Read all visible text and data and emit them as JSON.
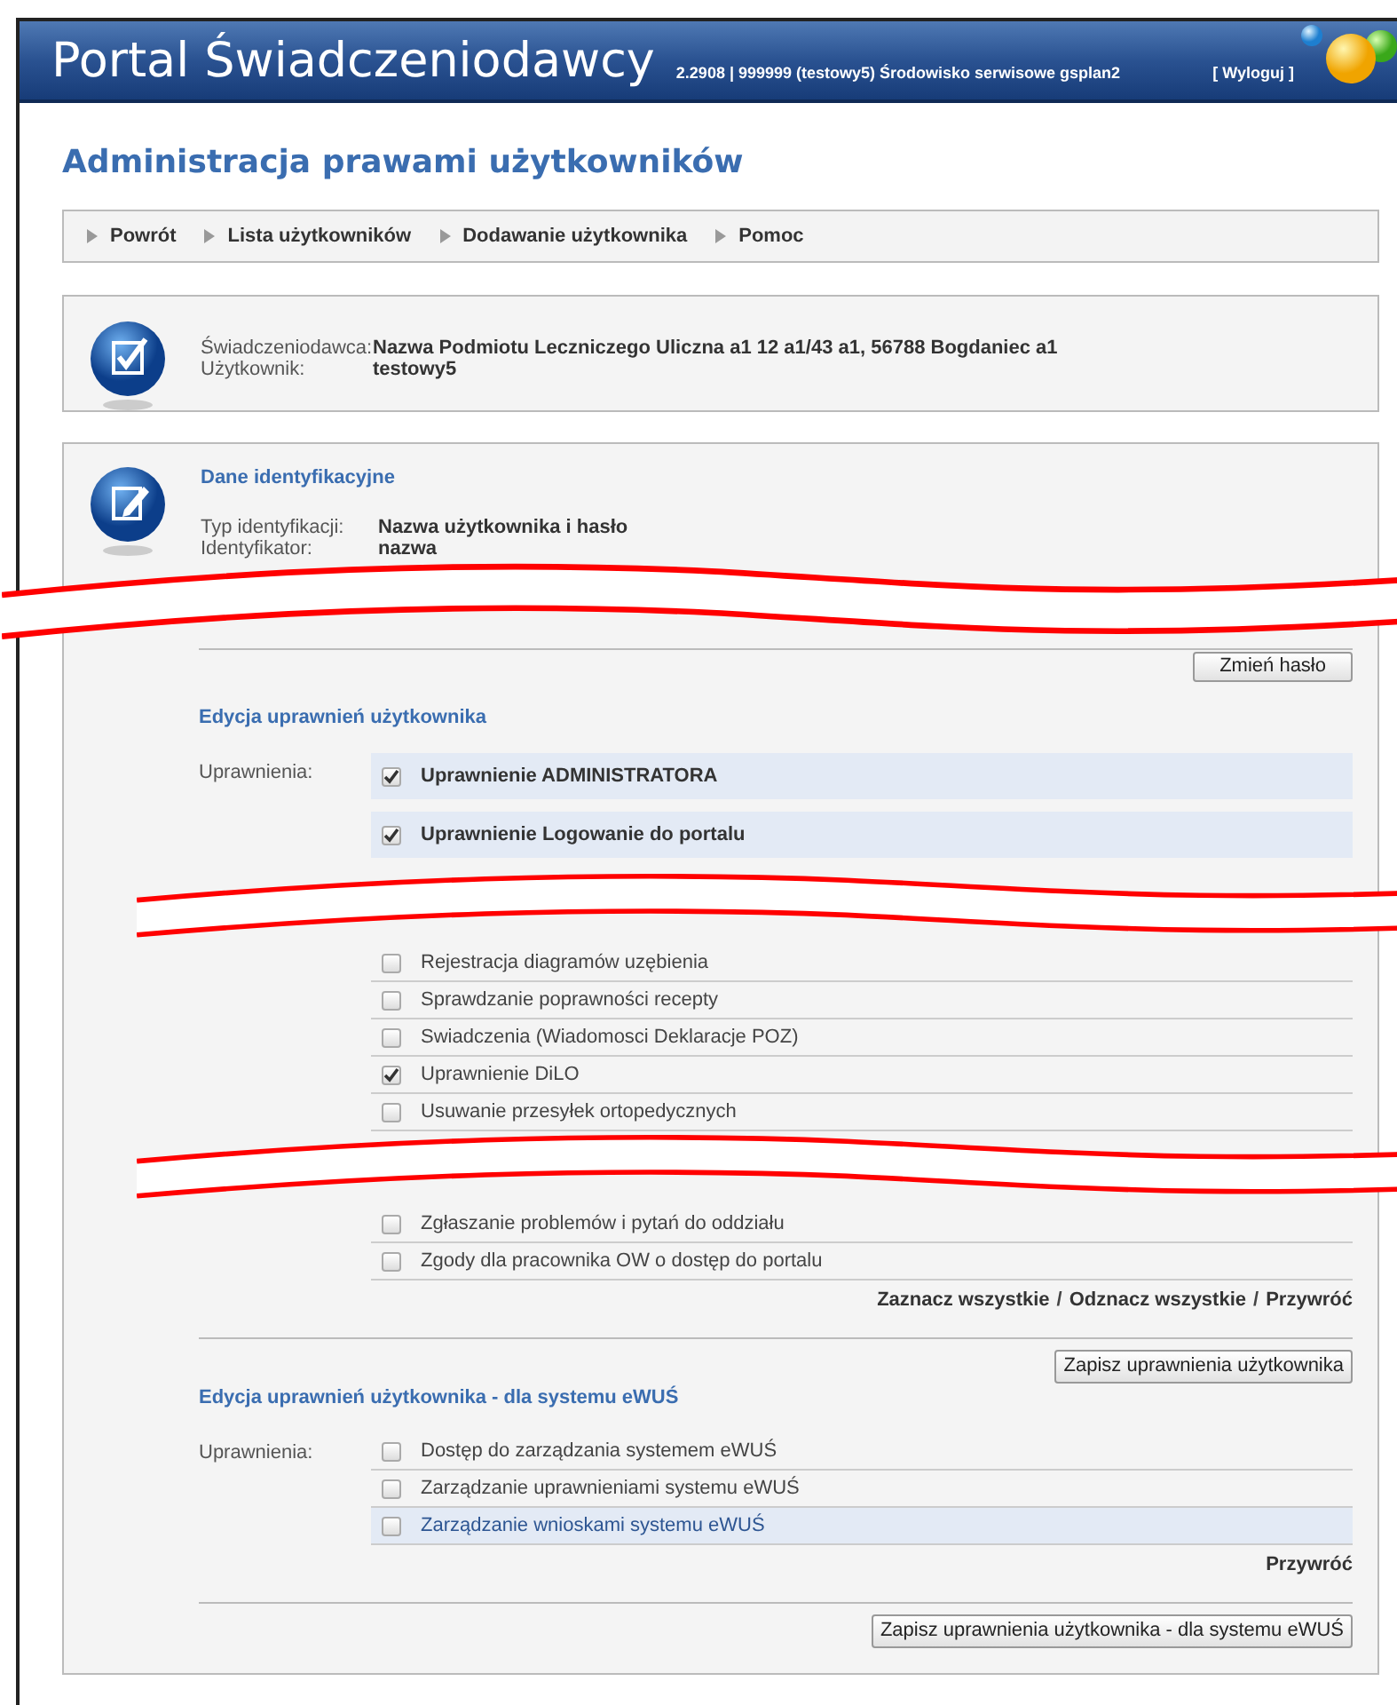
{
  "header": {
    "title": "Portal Świadczeniodawcy",
    "info": "2.2908 | 999999 (testowy5) Środowisko serwisowe gsplan2",
    "logout": "[ Wyloguj ]"
  },
  "page_title": "Administracja prawami użytkowników",
  "nav": [
    {
      "label": "Powrót"
    },
    {
      "label": "Lista użytkowników"
    },
    {
      "label": "Dodawanie użytkownika"
    },
    {
      "label": "Pomoc"
    }
  ],
  "provider_box": {
    "fields": [
      {
        "label": "Świadczeniodawca:",
        "value": "Nazwa Podmiotu Leczniczego Uliczna a1 12 a1/43 a1, 56788 Bogdaniec a1"
      },
      {
        "label": "Użytkownik:",
        "value": "testowy5"
      }
    ]
  },
  "identification": {
    "title": "Dane identyfikacyjne",
    "fields": [
      {
        "label": "Typ identyfikacji:",
        "value": "Nazwa użytkownika i hasło"
      },
      {
        "label": "Identyfikator:",
        "value": "nazwa"
      }
    ],
    "change_password_button": "Zmień hasło"
  },
  "permissions": {
    "title": "Edycja uprawnień użytkownika",
    "label": "Uprawnienia:",
    "item_groups": [
      [
        {
          "label": "Uprawnienie ADMINISTRATORA",
          "kind": "main",
          "checked": true,
          "highlighted": true
        },
        {
          "label": "Uprawnienie Logowanie do portalu",
          "kind": "main",
          "checked": true,
          "highlighted": true
        }
      ],
      [
        {
          "label": "Rejestracja diagramów uzębienia",
          "kind": "plain",
          "checked": false,
          "highlighted": false
        },
        {
          "label": "Sprawdzanie poprawności recepty",
          "kind": "plain",
          "checked": false,
          "highlighted": false
        },
        {
          "label": "Swiadczenia (Wiadomosci Deklaracje POZ)",
          "kind": "plain",
          "checked": false,
          "highlighted": false
        },
        {
          "label": "Uprawnienie DiLO",
          "kind": "plain",
          "checked": true,
          "highlighted": false
        },
        {
          "label": "Usuwanie przesyłek ortopedycznych",
          "kind": "plain",
          "checked": false,
          "highlighted": false
        }
      ],
      [
        {
          "label": "Zgłaszanie problemów i pytań do oddziału",
          "kind": "plain",
          "checked": false,
          "highlighted": false
        },
        {
          "label": "Zgody dla pracownika OW o dostęp do portalu",
          "kind": "plain",
          "checked": false,
          "highlighted": false
        }
      ]
    ],
    "links": [
      {
        "label": "Zaznacz wszystkie",
        "kind": "link"
      },
      {
        "label": "/",
        "kind": "separator"
      },
      {
        "label": "Odznacz wszystkie",
        "kind": "link"
      },
      {
        "label": "/",
        "kind": "separator"
      },
      {
        "label": "Przywróć",
        "kind": "link"
      }
    ],
    "save_button": "Zapisz uprawnienia użytkownika"
  },
  "ewus_permissions": {
    "title": "Edycja uprawnień użytkownika - dla systemu eWUŚ",
    "label": "Uprawnienia:",
    "item_groups": [
      [
        {
          "label": "Dostęp do zarządzania systemem eWUŚ",
          "kind": "plain",
          "checked": false,
          "highlighted": false
        },
        {
          "label": "Zarządzanie uprawnieniami systemu eWUŚ",
          "kind": "plain",
          "checked": false,
          "highlighted": false
        },
        {
          "label": "Zarządzanie wnioskami systemu eWUŚ",
          "kind": "plain",
          "checked": false,
          "highlighted": true
        }
      ]
    ],
    "links": [
      {
        "label": "Przywróć",
        "kind": "link"
      }
    ],
    "save_button": "Zapisz uprawnienia użytkownika - dla systemu eWUŚ"
  }
}
